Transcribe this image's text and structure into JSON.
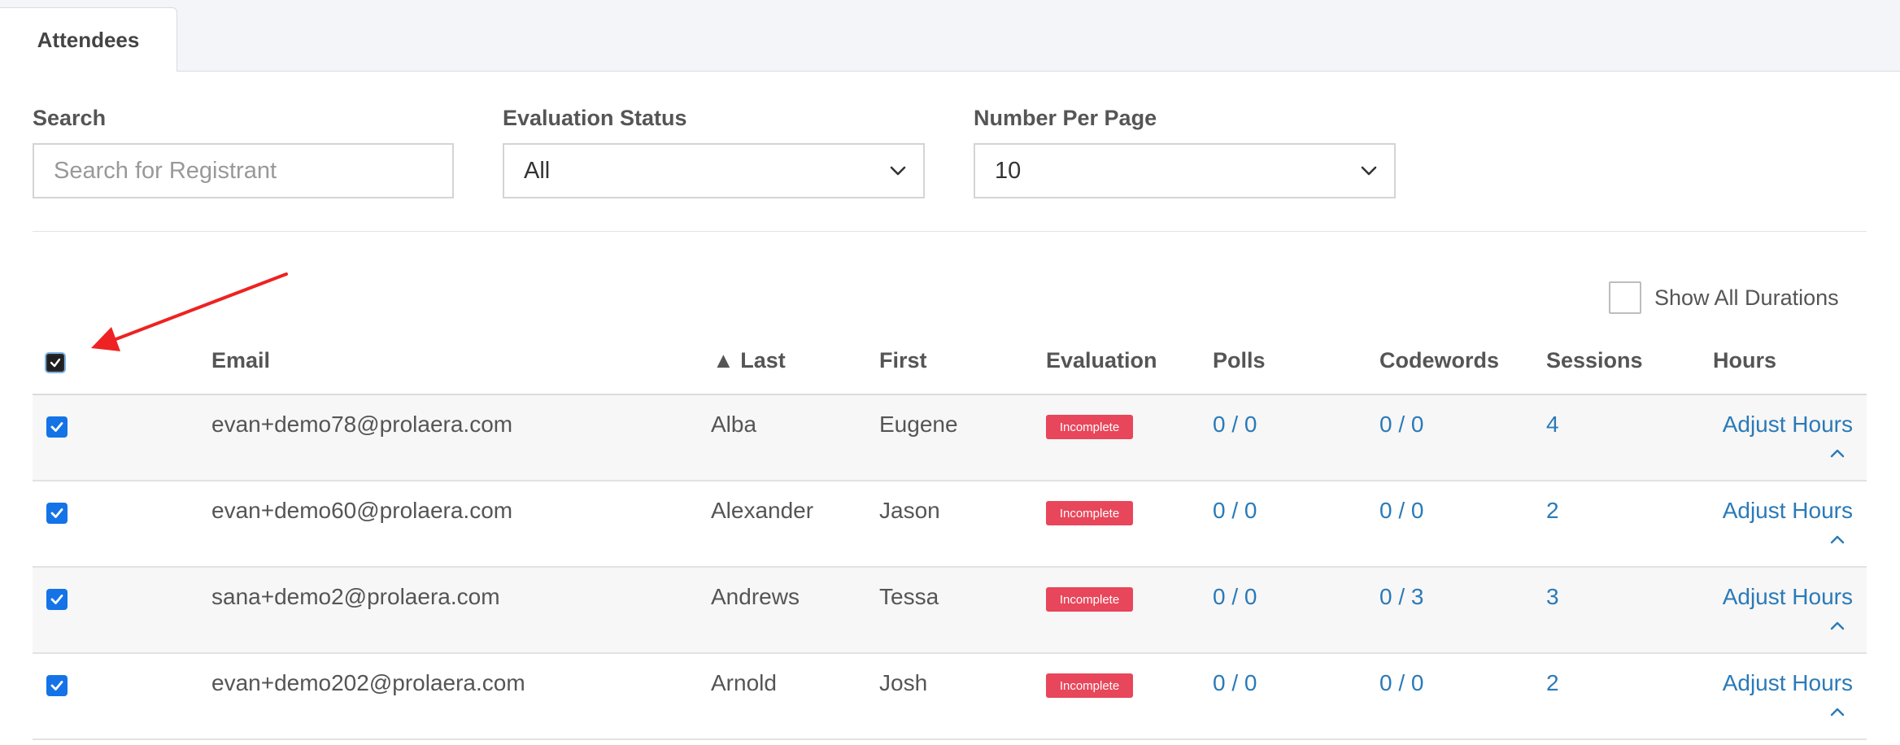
{
  "tabs": [
    {
      "label": "Attendees"
    }
  ],
  "filters": {
    "search": {
      "label": "Search",
      "placeholder": "Search for Registrant"
    },
    "evaluation_status": {
      "label": "Evaluation Status",
      "value": "All"
    },
    "per_page": {
      "label": "Number Per Page",
      "value": "10"
    }
  },
  "options": {
    "show_all_durations_label": "Show All Durations",
    "show_all_durations_checked": false
  },
  "table": {
    "select_all_checked": true,
    "columns": [
      "Email",
      "▲ Last",
      "First",
      "Evaluation",
      "Polls",
      "Codewords",
      "Sessions",
      "Hours"
    ],
    "rows": [
      {
        "email": "evan+demo78@prolaera.com",
        "last": "Alba",
        "first": "Eugene",
        "evaluation": "Incomplete",
        "polls": "0 / 0",
        "codewords": "0 / 0",
        "sessions": "4",
        "hours": "Adjust Hours",
        "checked": true
      },
      {
        "email": "evan+demo60@prolaera.com",
        "last": "Alexander",
        "first": "Jason",
        "evaluation": "Incomplete",
        "polls": "0 / 0",
        "codewords": "0 / 0",
        "sessions": "2",
        "hours": "Adjust Hours",
        "checked": true
      },
      {
        "email": "sana+demo2@prolaera.com",
        "last": "Andrews",
        "first": "Tessa",
        "evaluation": "Incomplete",
        "polls": "0 / 0",
        "codewords": "0 / 3",
        "sessions": "3",
        "hours": "Adjust Hours",
        "checked": true
      },
      {
        "email": "evan+demo202@prolaera.com",
        "last": "Arnold",
        "first": "Josh",
        "evaluation": "Incomplete",
        "polls": "0 / 0",
        "codewords": "0 / 0",
        "sessions": "2",
        "hours": "Adjust Hours",
        "checked": true
      }
    ]
  },
  "annotation": {
    "arrow_color": "#ee2222"
  },
  "colors": {
    "link": "#2a7ab8",
    "badge": "#e8465a",
    "checkbox": "#1473e6"
  }
}
